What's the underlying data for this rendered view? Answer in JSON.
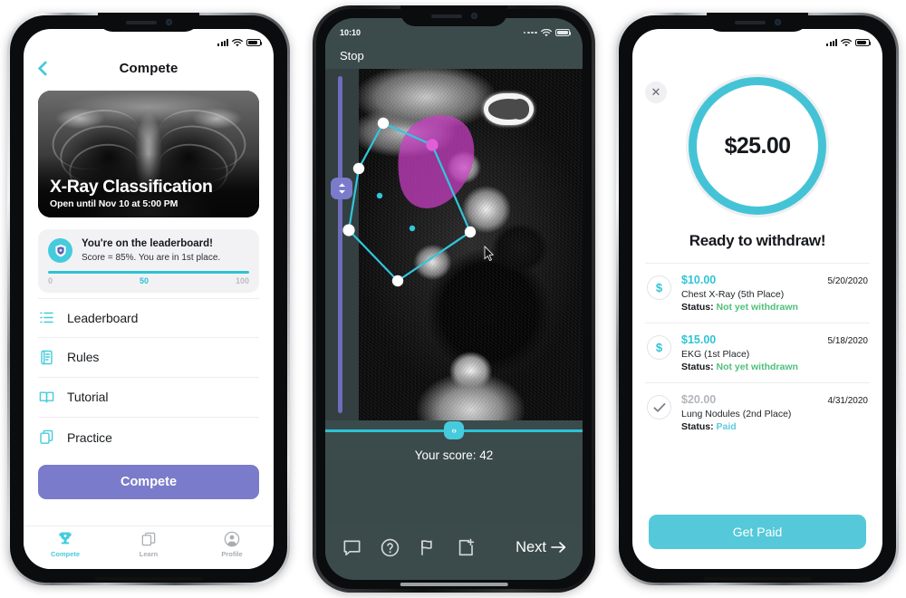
{
  "phone1": {
    "status": {
      "time": "",
      "signal": "signal-bars",
      "wifi": "wifi-icon",
      "battery": "battery-icon"
    },
    "nav": {
      "title": "Compete",
      "back": "back-chevron"
    },
    "hero": {
      "title": "X-Ray Classification",
      "subtitle": "Open until Nov 10 at 5:00 PM",
      "image": "chest-xray"
    },
    "leaderboard_card": {
      "icon": "shield-badge-icon",
      "headline": "You're on the leaderboard!",
      "detail": "Score = 85%. You are in 1st place.",
      "scale_min": "0",
      "scale_mid": "50",
      "scale_max": "100",
      "progress_color": "#2cc3d4"
    },
    "menu": [
      {
        "label": "Leaderboard",
        "icon": "list-icon"
      },
      {
        "label": "Rules",
        "icon": "document-icon"
      },
      {
        "label": "Tutorial",
        "icon": "book-icon"
      },
      {
        "label": "Practice",
        "icon": "copy-icon"
      }
    ],
    "cta": {
      "label": "Compete",
      "color": "#7a7bca"
    },
    "tabs": [
      {
        "label": "Compete",
        "icon": "trophy-icon",
        "active": true
      },
      {
        "label": "Learn",
        "icon": "cards-icon",
        "active": false
      },
      {
        "label": "Profile",
        "icon": "person-icon",
        "active": false
      }
    ]
  },
  "phone2": {
    "status": {
      "time": "10:10",
      "signal": "signal-dots",
      "wifi": "wifi-icon",
      "battery": "battery-icon"
    },
    "nav": {
      "stop_label": "Stop"
    },
    "viewer": {
      "image": "ct-scan-axial-chest",
      "annotation_color": "#32c6dd",
      "segmentation_color": "#cc3fc6",
      "vertical_slider_color": "#6e6dbb",
      "handle_icon": "up-down-chevron-icon",
      "cursor": "mouse-pointer"
    },
    "slider": {
      "handle_icon": "left-right-arrows-icon",
      "track_color": "#2cc3d4"
    },
    "score_label": "Your score: 42",
    "tools": [
      {
        "icon": "comment-icon"
      },
      {
        "icon": "question-circle-icon"
      },
      {
        "icon": "flag-icon"
      },
      {
        "icon": "add-document-icon"
      }
    ],
    "next": {
      "label": "Next",
      "icon": "arrow-right-icon"
    }
  },
  "phone3": {
    "status": {
      "time": "",
      "signal": "signal-bars",
      "wifi": "wifi-icon",
      "battery": "battery-icon"
    },
    "close_icon": "close-x-icon",
    "balance": {
      "amount": "$25.00",
      "ring_color": "#45c3d6",
      "track_color": "#efeff1"
    },
    "headline": "Ready to withdraw!",
    "payments": [
      {
        "amount": "$10.00",
        "date": "5/20/2020",
        "description": "Chest X-Ray (5th Place)",
        "status_label": "Status:",
        "status_value": "Not yet withdrawn",
        "icon": "dollar-circle-icon",
        "paid": false
      },
      {
        "amount": "$15.00",
        "date": "5/18/2020",
        "description": "EKG (1st Place)",
        "status_label": "Status:",
        "status_value": "Not yet withdrawn",
        "icon": "dollar-circle-icon",
        "paid": false
      },
      {
        "amount": "$20.00",
        "date": "4/31/2020",
        "description": "Lung Nodules (2nd Place)",
        "status_label": "Status:",
        "status_value": "Paid",
        "icon": "check-circle-icon",
        "paid": true
      }
    ],
    "cta": {
      "label": "Get Paid",
      "color": "#55c9d9"
    }
  }
}
